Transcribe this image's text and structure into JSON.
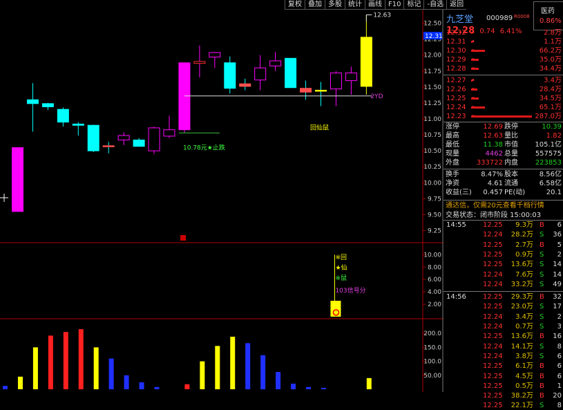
{
  "toolbar": {
    "items": [
      "复权",
      "叠加",
      "多股",
      "统计",
      "画线",
      "F10",
      "标记",
      "-自选",
      "返回"
    ]
  },
  "stock": {
    "name": "九芝堂",
    "code": "000989",
    "small_tag": "R0008",
    "industry": "医药",
    "industry_pct": "0.86%",
    "price": "12.28",
    "change": "0.74",
    "pct": "6.41%"
  },
  "order_book": {
    "asks": [
      {
        "price": "12.32",
        "vol": "2.8万",
        "bar": 0.01
      },
      {
        "price": "12.31",
        "vol": "1.1万",
        "bar": 0.004
      },
      {
        "price": "12.30",
        "vol": "66.2万",
        "bar": 0.23
      },
      {
        "price": "12.29",
        "vol": "35.0万",
        "bar": 0.12
      },
      {
        "price": "12.28",
        "vol": "34.4万",
        "bar": 0.12
      }
    ],
    "bids": [
      {
        "price": "12.27",
        "vol": "3.4万",
        "bar": 0.012
      },
      {
        "price": "12.26",
        "vol": "28.4万",
        "bar": 0.1
      },
      {
        "price": "12.25",
        "vol": "34.5万",
        "bar": 0.12
      },
      {
        "price": "12.24",
        "vol": "65.1万",
        "bar": 0.23
      },
      {
        "price": "12.23",
        "vol": "287.0万",
        "bar": 1.0
      }
    ]
  },
  "stats": [
    {
      "l1": "涨停",
      "v1": "12.69",
      "c1": "red",
      "l2": "跌停",
      "v2": "10.39",
      "c2": "grn"
    },
    {
      "l1": "最高",
      "v1": "12.63",
      "c1": "red",
      "l2": "量比",
      "v2": "1.82",
      "c2": "red"
    },
    {
      "l1": "最低",
      "v1": "11.38",
      "c1": "grn",
      "l2": "市值",
      "v2": "105.1亿",
      "c2": "wht"
    },
    {
      "l1": "现量",
      "v1": "4462",
      "c1": "mag",
      "l2": "总量",
      "v2": "557575",
      "c2": "wht"
    },
    {
      "l1": "外盘",
      "v1": "333722",
      "c1": "red",
      "l2": "内盘",
      "v2": "223853",
      "c2": "grn"
    }
  ],
  "stats2": [
    {
      "l1": "换手",
      "v1": "8.47%",
      "c1": "wht",
      "l2": "股本",
      "v2": "8.56亿",
      "c2": "wht"
    },
    {
      "l1": "净资",
      "v1": "4.61",
      "c1": "wht",
      "l2": "流通",
      "v2": "6.58亿",
      "c2": "wht"
    },
    {
      "l1": "收益(三)",
      "v1": "0.457",
      "c1": "wht",
      "l2": "PE(动)",
      "v2": "20.1",
      "c2": "wht"
    }
  ],
  "promo": "通达信，仅需20元查看千档行情",
  "trade_status": "交易状态：闭市阶段 15:00:03",
  "ticks": [
    {
      "time": "14:55",
      "price": "12.25",
      "vol": "9.3万",
      "side": "B",
      "n": "6"
    },
    {
      "time": "",
      "price": "12.24",
      "vol": "28.2万",
      "side": "S",
      "n": "36"
    },
    {
      "time": "",
      "price": "12.25",
      "vol": "2.7万",
      "side": "B",
      "n": "5"
    },
    {
      "time": "",
      "price": "12.25",
      "vol": "0.9万",
      "side": "S",
      "n": "2"
    },
    {
      "time": "",
      "price": "12.25",
      "vol": "13.6万",
      "side": "S",
      "n": "14"
    },
    {
      "time": "",
      "price": "12.24",
      "vol": "7.6万",
      "side": "S",
      "n": "14"
    },
    {
      "time": "",
      "price": "12.24",
      "vol": "33.2万",
      "side": "S",
      "n": "49"
    },
    {
      "time": "14:56",
      "price": "12.25",
      "vol": "29.3万",
      "side": "B",
      "n": "32"
    },
    {
      "time": "",
      "price": "12.25",
      "vol": "23.0万",
      "side": "S",
      "n": "17"
    },
    {
      "time": "",
      "price": "12.24",
      "vol": "3.4万",
      "side": "S",
      "n": "2"
    },
    {
      "time": "",
      "price": "12.24",
      "vol": "0.7万",
      "side": "S",
      "n": "3"
    },
    {
      "time": "",
      "price": "12.25",
      "vol": "13.6万",
      "side": "B",
      "n": "16"
    },
    {
      "time": "",
      "price": "12.24",
      "vol": "14.1万",
      "side": "S",
      "n": "8"
    },
    {
      "time": "",
      "price": "12.24",
      "vol": "3.8万",
      "side": "S",
      "n": "6"
    },
    {
      "time": "",
      "price": "12.25",
      "vol": "6.1万",
      "side": "B",
      "n": "6"
    },
    {
      "time": "",
      "price": "12.25",
      "vol": "4.5万",
      "side": "B",
      "n": "6"
    },
    {
      "time": "",
      "price": "12.25",
      "vol": "0.5万",
      "side": "B",
      "n": "1"
    },
    {
      "time": "",
      "price": "12.25",
      "vol": "38.2万",
      "side": "B",
      "n": "20"
    },
    {
      "time": "",
      "price": "12.25",
      "vol": "22.1万",
      "side": "S",
      "n": "8"
    }
  ],
  "colors": {
    "up": "#ff00ff",
    "down": "#00ffff",
    "red": "#ff3030",
    "green": "#20d020",
    "yellow": "#ffff00",
    "blue": "#2030ff"
  },
  "chart_data": [
    {
      "type": "candlestick",
      "y_ticks": [
        "12.50",
        "12.25",
        "12.00",
        "11.75",
        "11.50",
        "11.25",
        "11.00",
        "10.75",
        "10.50",
        "10.25",
        "10.00",
        "9.75",
        "9.50",
        "9.25"
      ],
      "ylim": [
        9.18,
        12.56
      ],
      "current_price_label": "12.31",
      "high_marker": "12.63",
      "support_label": "10.78元★止跌",
      "support_value": 10.78,
      "level_label": "2YD",
      "level_value": 11.36,
      "signal_label": "回仙鼠",
      "candles": [
        {
          "o": 9.55,
          "h": 10.55,
          "l": 9.55,
          "c": 10.55
        },
        {
          "o": 11.3,
          "h": 11.56,
          "l": 10.8,
          "c": 11.24
        },
        {
          "o": 11.24,
          "h": 11.25,
          "l": 11.14,
          "c": 11.19
        },
        {
          "o": 11.15,
          "h": 11.18,
          "l": 10.88,
          "c": 10.95
        },
        {
          "o": 10.92,
          "h": 10.95,
          "l": 10.74,
          "c": 10.9
        },
        {
          "o": 10.9,
          "h": 10.91,
          "l": 10.48,
          "c": 10.5
        },
        {
          "o": 10.58,
          "h": 10.64,
          "l": 10.46,
          "c": 10.57
        },
        {
          "o": 10.67,
          "h": 10.79,
          "l": 10.59,
          "c": 10.74
        },
        {
          "o": 10.67,
          "h": 10.7,
          "l": 10.6,
          "c": 10.57
        },
        {
          "o": 10.5,
          "h": 10.88,
          "l": 10.45,
          "c": 10.86
        },
        {
          "o": 10.73,
          "h": 11.05,
          "l": 10.7,
          "c": 10.83
        },
        {
          "o": 10.83,
          "h": 11.88,
          "l": 10.78,
          "c": 11.88
        },
        {
          "o": 11.87,
          "h": 12.15,
          "l": 11.65,
          "c": 11.9
        },
        {
          "o": 11.97,
          "h": 12.05,
          "l": 11.8,
          "c": 12.04
        },
        {
          "o": 11.88,
          "h": 11.98,
          "l": 11.4,
          "c": 11.48
        },
        {
          "o": 11.55,
          "h": 11.63,
          "l": 11.45,
          "c": 11.51
        },
        {
          "o": 11.61,
          "h": 12.0,
          "l": 11.45,
          "c": 11.8
        },
        {
          "o": 11.83,
          "h": 12.05,
          "l": 11.75,
          "c": 11.91
        },
        {
          "o": 11.95,
          "h": 11.95,
          "l": 11.6,
          "c": 11.49
        },
        {
          "o": 11.48,
          "h": 11.6,
          "l": 11.3,
          "c": 11.42
        },
        {
          "o": 11.45,
          "h": 11.58,
          "l": 11.2,
          "c": 11.44
        },
        {
          "o": 11.47,
          "h": 11.75,
          "l": 11.2,
          "c": 11.72
        },
        {
          "o": 11.6,
          "h": 11.82,
          "l": 11.38,
          "c": 11.72
        },
        {
          "o": 11.51,
          "h": 12.63,
          "l": 11.38,
          "c": 12.28
        }
      ]
    },
    {
      "type": "indicator",
      "y_ticks": [
        "10.00",
        "8.00",
        "6.00",
        "4.00",
        "2.00"
      ],
      "ylim": [
        0,
        11.6
      ],
      "labels": [
        "※回",
        "★仙",
        "※鼠",
        "103信号分"
      ],
      "signal_value": 10
    },
    {
      "type": "bar",
      "y_ticks": [
        "200.0",
        "150.0",
        "100.0",
        "50.00"
      ],
      "ylim": [
        0,
        240
      ],
      "values": [
        12,
        45,
        150,
        192,
        205,
        215,
        150,
        110,
        50,
        25,
        8,
        0,
        18,
        100,
        155,
        188,
        165,
        122,
        62,
        20,
        8,
        5,
        0,
        0,
        40
      ],
      "colors": [
        "blue",
        "yellow",
        "yellow",
        "red",
        "red",
        "red",
        "yellow",
        "blue",
        "blue",
        "blue",
        "blue",
        "blue",
        "red",
        "yellow",
        "yellow",
        "yellow",
        "blue",
        "blue",
        "blue",
        "blue",
        "blue",
        "blue",
        "blue",
        "blue",
        "yellow"
      ]
    }
  ]
}
